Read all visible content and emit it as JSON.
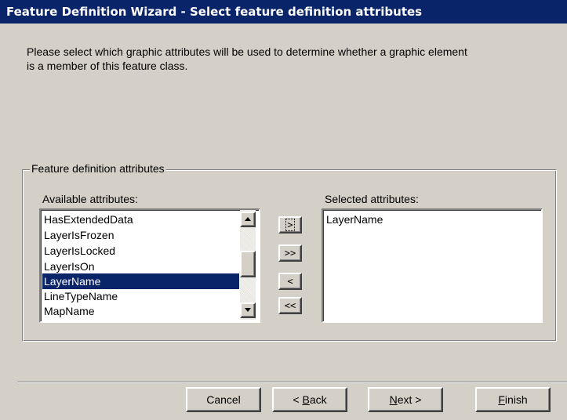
{
  "window": {
    "title": "Feature Definition Wizard - Select feature definition attributes"
  },
  "instructions": {
    "line1": "Please select which graphic attributes will be used to determine whether a graphic element",
    "line2": "is a member of this feature class."
  },
  "group": {
    "legend": "Feature definition attributes",
    "available_label": "Available attributes:",
    "selected_label": "Selected attributes:",
    "available_items": [
      {
        "label": "HasExtendedData",
        "selected": false
      },
      {
        "label": "LayerIsFrozen",
        "selected": false
      },
      {
        "label": "LayerIsLocked",
        "selected": false
      },
      {
        "label": "LayerIsOn",
        "selected": false
      },
      {
        "label": "LayerName",
        "selected": true
      },
      {
        "label": "LineTypeName",
        "selected": false
      },
      {
        "label": "MapName",
        "selected": false
      }
    ],
    "selected_items": [
      "LayerName"
    ],
    "move_buttons": {
      "add": ">",
      "add_all": ">>",
      "remove": "<",
      "remove_all": "<<"
    }
  },
  "footer": {
    "cancel": "Cancel",
    "back_prefix": "< ",
    "back_mnemonic": "B",
    "back_rest": "ack",
    "next_mnemonic": "N",
    "next_rest": "ext >",
    "finish_mnemonic": "F",
    "finish_rest": "inish"
  },
  "colors": {
    "dialog_bg": "#d4d0c8",
    "title_bg": "#0a246a",
    "selection_bg": "#0a246a"
  }
}
